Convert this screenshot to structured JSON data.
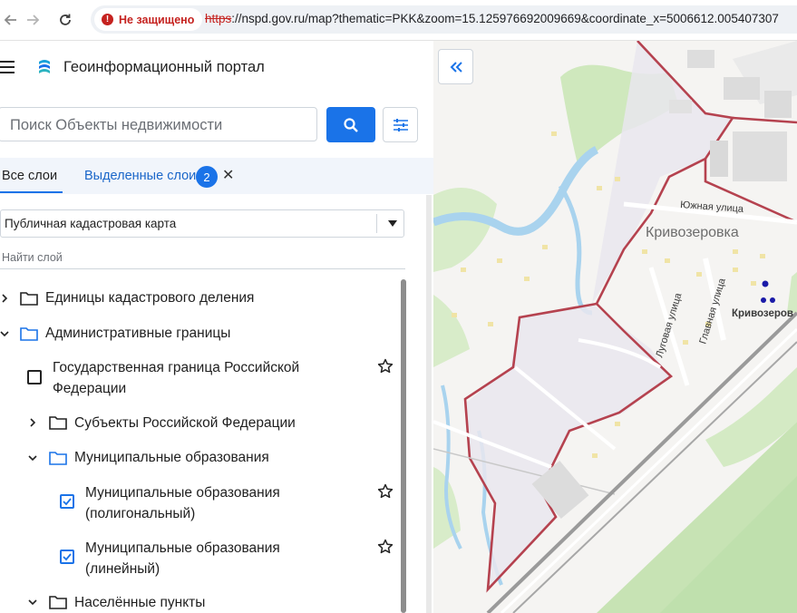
{
  "browser": {
    "security_label": "Не защищено",
    "url_protocol": "https",
    "url_rest": "://nspd.gov.ru/map?thematic=PKK&zoom=15.125976692009669&coordinate_x=5006612.005407307"
  },
  "header": {
    "title": "Геоинформационный портал"
  },
  "search": {
    "placeholder": "Поиск Объекты недвижимости"
  },
  "tabs": {
    "all_label": "Все слои",
    "selected_label": "Выделенные слои",
    "selected_count": "2"
  },
  "basemap": {
    "selected": "Публичная кадастровая карта"
  },
  "layer_search": {
    "placeholder": "Найти слой"
  },
  "tree": [
    {
      "label": "Единицы кадастрового деления",
      "kind": "folder",
      "state": "collapsed"
    },
    {
      "label": "Административные границы",
      "kind": "folder",
      "state": "expanded"
    },
    {
      "label": "Государственная граница Российской",
      "label2": "Федерации",
      "kind": "layer",
      "checked": false
    },
    {
      "label": "Субъекты Российской Федерации",
      "kind": "folder",
      "state": "collapsed"
    },
    {
      "label": "Муниципальные образования",
      "kind": "folder",
      "state": "expanded"
    },
    {
      "label": "Муниципальные образования",
      "label2": "(полигональный)",
      "kind": "layer",
      "checked": true
    },
    {
      "label": "Муниципальные образования",
      "label2": "(линейный)",
      "kind": "layer",
      "checked": true
    },
    {
      "label": "Населённые пункты",
      "kind": "folder",
      "state": "expanded"
    }
  ],
  "map": {
    "place_name": "Кривозеровка",
    "place_name_cut": "Кривозеров",
    "streets": {
      "south": "Южная улица",
      "main": "Главная улица",
      "meadow": "Луговая улица"
    }
  },
  "colors": {
    "accent": "#1a73e8",
    "boundary": "#b5424f",
    "insecure": "#c5221f"
  }
}
